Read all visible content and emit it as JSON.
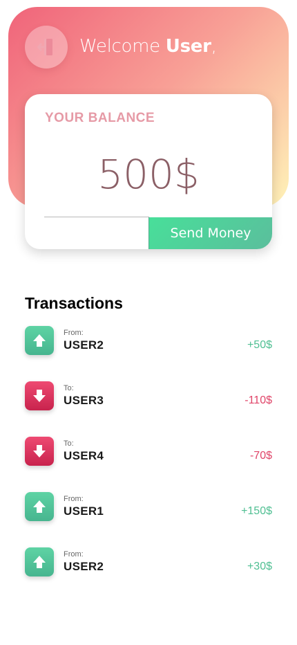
{
  "header": {
    "welcome_prefix": "Welcome ",
    "username": "User",
    "welcome_suffix": ",",
    "logout_icon": "logout-icon"
  },
  "balance": {
    "label": "YOUR BALANCE",
    "amount": "500$",
    "send_label": "Send Money"
  },
  "transactions": {
    "title": "Transactions",
    "items": [
      {
        "direction": "From:",
        "user": "USER2",
        "amount": "+50$",
        "type": "in"
      },
      {
        "direction": "To:",
        "user": "USER3",
        "amount": "-110$",
        "type": "out"
      },
      {
        "direction": "To:",
        "user": "USER4",
        "amount": "-70$",
        "type": "out"
      },
      {
        "direction": "From:",
        "user": "USER1",
        "amount": "+150$",
        "type": "in"
      },
      {
        "direction": "From:",
        "user": "USER2",
        "amount": "+30$",
        "type": "in"
      }
    ]
  },
  "colors": {
    "incoming": "#4fbf92",
    "outgoing": "#e04468",
    "header_start": "#f0647a",
    "header_end": "#fff3b8"
  }
}
